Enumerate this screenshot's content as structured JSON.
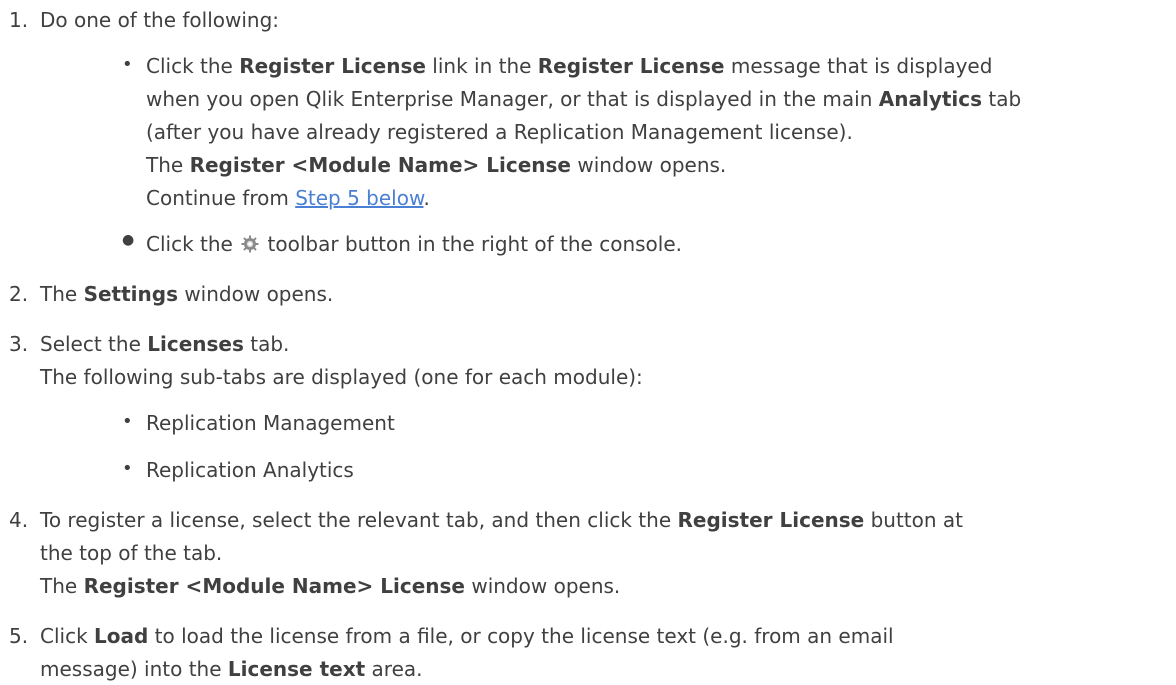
{
  "step1": {
    "number": "1.",
    "intro": "Do one of the following:",
    "optA": {
      "p1": "Click the ",
      "b1": "Register License",
      "p2": " link in the ",
      "b2": "Register License",
      "p3": " message that is displayed",
      "line2a": "when you open Qlik Enterprise Manager, or that is displayed in the main ",
      "line2b": "Analytics",
      "line2c": " tab",
      "line3": "(after you have already registered a Replication Management license).",
      "line4a": "The ",
      "line4b": "Register <Module Name> License",
      "line4c": " window opens.",
      "line5a": "Continue from ",
      "link": "Step 5 below",
      "line5b": "."
    },
    "optB": {
      "pre": "Click the ",
      "icon": "gear-icon",
      "post": " toolbar button in the right of the console."
    }
  },
  "step2": {
    "number": "2.",
    "pre": "The ",
    "bold": "Settings",
    "post": " window opens."
  },
  "step3": {
    "number": "3.",
    "pre": "Select the ",
    "bold": "Licenses",
    "post": " tab.",
    "line2": "The following sub-tabs are displayed (one for each module):",
    "items": [
      "Replication Management",
      "Replication Analytics"
    ]
  },
  "step4": {
    "number": "4.",
    "pre": "To register a license, select the relevant tab, and then click the ",
    "bold": "Register License",
    "post": " button at",
    "line2": "the top of the tab.",
    "line3a": "The ",
    "line3b": "Register <Module Name> License",
    "line3c": " window opens."
  },
  "step5": {
    "number": "5.",
    "pre": "Click ",
    "bold": "Load",
    "post": " to load the license from a file, or copy the license text (e.g. from an email",
    "line2a": "message) into the ",
    "line2b": "License text",
    "line2c": " area."
  },
  "colors": {
    "text": "#404040",
    "link": "#4a7fd4"
  }
}
